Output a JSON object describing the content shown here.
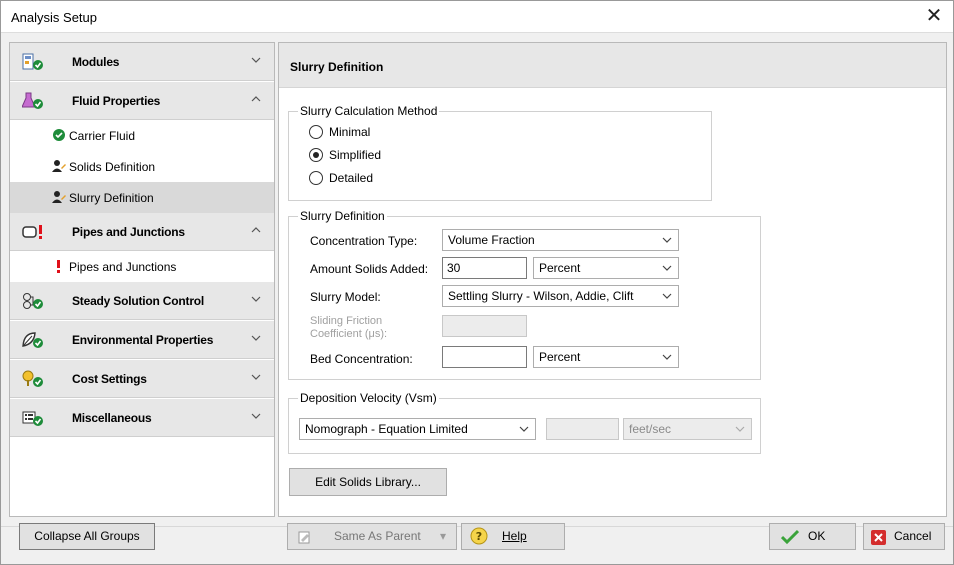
{
  "window": {
    "title": "Analysis Setup"
  },
  "sidebar": {
    "groups": [
      {
        "label": "Modules",
        "icon": "modules-icon",
        "expanded": false
      },
      {
        "label": "Fluid Properties",
        "icon": "flask-icon",
        "expanded": true,
        "items": [
          {
            "label": "Carrier Fluid",
            "status": "complete"
          },
          {
            "label": "Solids Definition",
            "status": "user"
          },
          {
            "label": "Slurry Definition",
            "status": "user",
            "selected": true
          }
        ]
      },
      {
        "label": "Pipes and Junctions",
        "icon": "pipe-icon",
        "expanded": true,
        "items": [
          {
            "label": "Pipes and Junctions",
            "status": "warning"
          }
        ]
      },
      {
        "label": "Steady Solution Control",
        "icon": "solution-icon",
        "expanded": false
      },
      {
        "label": "Environmental Properties",
        "icon": "leaf-icon",
        "expanded": false
      },
      {
        "label": "Cost Settings",
        "icon": "cost-icon",
        "expanded": false
      },
      {
        "label": "Miscellaneous",
        "icon": "misc-icon",
        "expanded": false
      }
    ]
  },
  "panel": {
    "title": "Slurry Definition",
    "calc_method": {
      "title": "Slurry Calculation Method",
      "options": [
        "Minimal",
        "Simplified",
        "Detailed"
      ],
      "selected": "Simplified"
    },
    "slurry_def": {
      "title": "Slurry Definition",
      "concentration_type_label": "Concentration Type:",
      "concentration_type_value": "Volume Fraction",
      "amount_label": "Amount Solids Added:",
      "amount_value": "30",
      "amount_unit": "Percent",
      "model_label": "Slurry Model:",
      "model_value": "Settling Slurry - Wilson, Addie, Clift",
      "sliding_label_1": "Sliding Friction",
      "sliding_label_2": "Coefficient (μs):",
      "sliding_value": "",
      "bed_label": "Bed Concentration:",
      "bed_value": "",
      "bed_unit": "Percent"
    },
    "deposition": {
      "title": "Deposition Velocity (Vsm)",
      "method_value": "Nomograph - Equation Limited",
      "velocity_value": "",
      "velocity_unit": "feet/sec"
    },
    "edit_library_label": "Edit Solids Library..."
  },
  "footer": {
    "collapse_label": "Collapse All Groups",
    "same_as_parent_label": "Same As Parent",
    "help_label": "Help",
    "ok_label": "OK",
    "cancel_label": "Cancel"
  },
  "colors": {
    "complete": "#1e8c3a",
    "warning": "#e0101a",
    "cancel": "#d42d2d",
    "ok": "#3aa33a"
  }
}
